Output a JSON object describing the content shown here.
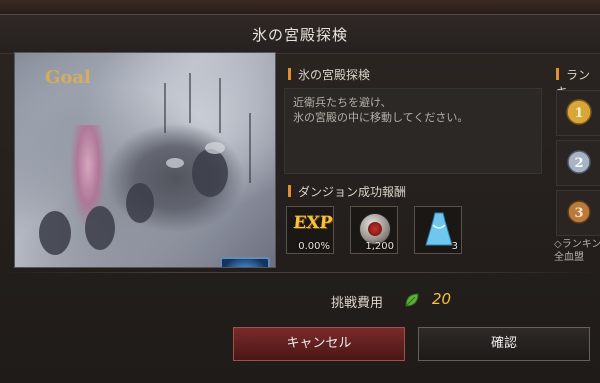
{
  "dialog": {
    "title": "氷の宮殿探検"
  },
  "scene": {
    "goal_label": "Goal",
    "skill_icon": "ice-skill-icon"
  },
  "mission": {
    "header": "氷の宮殿探検",
    "description_line1": "近衛兵たちを避け、",
    "description_line2": "氷の宮殿の中に移動してください。"
  },
  "rewards": {
    "header": "ダンジョン成功報酬",
    "items": [
      {
        "icon": "exp-icon",
        "label": "EXP",
        "qty": "0.00%"
      },
      {
        "icon": "coin-icon",
        "qty": "1,200"
      },
      {
        "icon": "dress-icon",
        "qty": "3"
      }
    ]
  },
  "ranking": {
    "header": "ランキ",
    "medals": [
      "1",
      "2",
      "3"
    ],
    "note_line1": "◇ランキン",
    "note_line2": "全血盟"
  },
  "cost": {
    "label": "挑戦費用",
    "value": "20"
  },
  "buttons": {
    "cancel": "キャンセル",
    "confirm": "確認"
  },
  "colors": {
    "accent": "#e0902e",
    "cost_value": "#f0c23c",
    "cancel_button": "#7a2a2a"
  }
}
